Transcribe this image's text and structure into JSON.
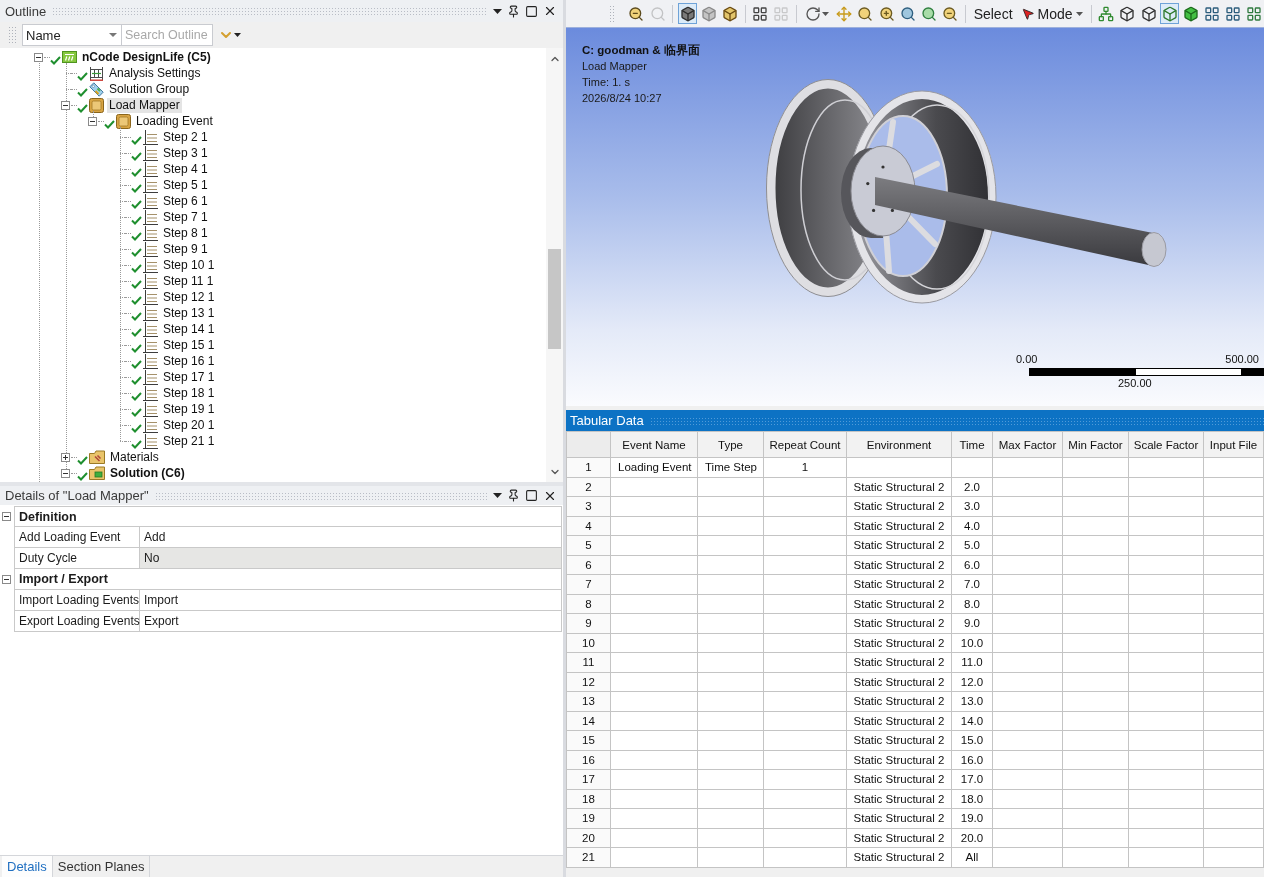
{
  "outline": {
    "title": "Outline",
    "filter": {
      "value": "Name"
    },
    "search": {
      "placeholder": "Search Outline"
    },
    "tree": [
      {
        "label": "nCode DesignLife (C5)",
        "kind": "system",
        "solved": true,
        "expanded": true,
        "selected": false,
        "children": [
          {
            "label": "Analysis Settings",
            "kind": "settings",
            "solved": true,
            "selected": false
          },
          {
            "label": "Solution Group",
            "kind": "group",
            "solved": true,
            "selected": false
          },
          {
            "label": "Load Mapper",
            "kind": "mapper",
            "solved": true,
            "expanded": true,
            "selected": true,
            "children": [
              {
                "label": "Loading Event",
                "kind": "event",
                "solved": true,
                "expanded": true,
                "selected": false,
                "children": [
                  {
                    "label": "Step 2 1",
                    "kind": "step",
                    "solved": true,
                    "selected": false
                  },
                  {
                    "label": "Step 3 1",
                    "kind": "step",
                    "solved": true,
                    "selected": false
                  },
                  {
                    "label": "Step 4 1",
                    "kind": "step",
                    "solved": true,
                    "selected": false
                  },
                  {
                    "label": "Step 5 1",
                    "kind": "step",
                    "solved": true,
                    "selected": false
                  },
                  {
                    "label": "Step 6 1",
                    "kind": "step",
                    "solved": true,
                    "selected": false
                  },
                  {
                    "label": "Step 7 1",
                    "kind": "step",
                    "solved": true,
                    "selected": false
                  },
                  {
                    "label": "Step 8 1",
                    "kind": "step",
                    "solved": true,
                    "selected": false
                  },
                  {
                    "label": "Step 9 1",
                    "kind": "step",
                    "solved": true,
                    "selected": false
                  },
                  {
                    "label": "Step 10 1",
                    "kind": "step",
                    "solved": true,
                    "selected": false
                  },
                  {
                    "label": "Step 11 1",
                    "kind": "step",
                    "solved": true,
                    "selected": false
                  },
                  {
                    "label": "Step 12 1",
                    "kind": "step",
                    "solved": true,
                    "selected": false
                  },
                  {
                    "label": "Step 13 1",
                    "kind": "step",
                    "solved": true,
                    "selected": false
                  },
                  {
                    "label": "Step 14 1",
                    "kind": "step",
                    "solved": true,
                    "selected": false
                  },
                  {
                    "label": "Step 15 1",
                    "kind": "step",
                    "solved": true,
                    "selected": false
                  },
                  {
                    "label": "Step 16 1",
                    "kind": "step",
                    "solved": true,
                    "selected": false
                  },
                  {
                    "label": "Step 17 1",
                    "kind": "step",
                    "solved": true,
                    "selected": false
                  },
                  {
                    "label": "Step 18 1",
                    "kind": "step",
                    "solved": true,
                    "selected": false
                  },
                  {
                    "label": "Step 19 1",
                    "kind": "step",
                    "solved": true,
                    "selected": false
                  },
                  {
                    "label": "Step 20 1",
                    "kind": "step",
                    "solved": true,
                    "selected": false
                  },
                  {
                    "label": "Step 21 1",
                    "kind": "step",
                    "solved": true,
                    "selected": false
                  }
                ]
              }
            ]
          },
          {
            "label": "Materials",
            "kind": "materials",
            "solved": true,
            "expanded": false,
            "selected": false
          },
          {
            "label": "Solution (C6)",
            "kind": "solution",
            "solved": true,
            "expanded": true,
            "selected": false
          }
        ]
      }
    ]
  },
  "details": {
    "title": "Details of \"Load Mapper\"",
    "groups": [
      {
        "label": "Definition",
        "expanded": true,
        "rows": [
          {
            "name": "Add Loading Event",
            "value": "Add",
            "selected": false
          },
          {
            "name": "Duty Cycle",
            "value": "No",
            "selected": true
          }
        ]
      },
      {
        "label": "Import / Export",
        "expanded": true,
        "rows": [
          {
            "name": "Import Loading Events",
            "value": "Import",
            "selected": false
          },
          {
            "name": "Export Loading Events",
            "value": "Export",
            "selected": false
          }
        ]
      }
    ]
  },
  "bottom_tabs": [
    {
      "label": "Details",
      "selected": true
    },
    {
      "label": "Section Planes",
      "selected": false
    }
  ],
  "graphics_toolbar": {
    "items": [
      {
        "kind": "icon",
        "selected": false,
        "disabled": false
      },
      {
        "kind": "icon",
        "selected": false,
        "disabled": true
      },
      {
        "kind": "separator"
      },
      {
        "kind": "icon",
        "selected": true,
        "disabled": false
      },
      {
        "kind": "icon",
        "selected": false,
        "disabled": false
      },
      {
        "kind": "icon",
        "selected": false,
        "disabled": false
      },
      {
        "kind": "separator"
      },
      {
        "kind": "icon",
        "selected": false,
        "disabled": false
      },
      {
        "kind": "icon",
        "selected": false,
        "disabled": true
      },
      {
        "kind": "separator"
      },
      {
        "kind": "dropdown",
        "selected": false,
        "disabled": false
      },
      {
        "kind": "icon",
        "selected": false,
        "disabled": false
      },
      {
        "kind": "icon",
        "selected": false,
        "disabled": false
      },
      {
        "kind": "icon",
        "selected": false,
        "disabled": false
      },
      {
        "kind": "icon",
        "selected": false,
        "disabled": false
      },
      {
        "kind": "icon",
        "selected": false,
        "disabled": false
      },
      {
        "kind": "icon",
        "selected": false,
        "disabled": false
      },
      {
        "kind": "separator"
      },
      {
        "kind": "text",
        "label": "Select"
      },
      {
        "kind": "mode",
        "label": "Mode"
      },
      {
        "kind": "separator"
      },
      {
        "kind": "icon",
        "selected": false,
        "disabled": false
      },
      {
        "kind": "icon",
        "selected": false,
        "disabled": false
      },
      {
        "kind": "icon",
        "selected": false,
        "disabled": false
      },
      {
        "kind": "icon",
        "selected": true,
        "disabled": false
      },
      {
        "kind": "icon",
        "selected": false,
        "disabled": false
      },
      {
        "kind": "icon",
        "selected": false,
        "disabled": false
      },
      {
        "kind": "icon",
        "selected": false,
        "disabled": false
      },
      {
        "kind": "icon",
        "selected": false,
        "disabled": false
      }
    ]
  },
  "viewport": {
    "annotation": {
      "title": "C: goodman & 临界面",
      "lines": [
        "Load Mapper",
        "Time: 1. s",
        "2026/8/24 10:27"
      ]
    },
    "scale_bar": {
      "start": "0.00",
      "middle": "250.00",
      "end": "500.00"
    }
  },
  "tabular_data": {
    "title": "Tabular Data",
    "columns": [
      "Event Name",
      "Type",
      "Repeat Count",
      "Environment",
      "Time",
      "Max Factor",
      "Min Factor",
      "Scale Factor",
      "Input File"
    ],
    "rows": [
      {
        "number": "1",
        "event_name": "Loading Event",
        "type": "Time Step",
        "repeat_count": "1"
      },
      {
        "number": "2",
        "environment": "Static Structural 2",
        "time": "2.0"
      },
      {
        "number": "3",
        "environment": "Static Structural 2",
        "time": "3.0"
      },
      {
        "number": "4",
        "environment": "Static Structural 2",
        "time": "4.0"
      },
      {
        "number": "5",
        "environment": "Static Structural 2",
        "time": "5.0"
      },
      {
        "number": "6",
        "environment": "Static Structural 2",
        "time": "6.0"
      },
      {
        "number": "7",
        "environment": "Static Structural 2",
        "time": "7.0"
      },
      {
        "number": "8",
        "environment": "Static Structural 2",
        "time": "8.0"
      },
      {
        "number": "9",
        "environment": "Static Structural 2",
        "time": "9.0"
      },
      {
        "number": "10",
        "environment": "Static Structural 2",
        "time": "10.0"
      },
      {
        "number": "11",
        "environment": "Static Structural 2",
        "time": "11.0"
      },
      {
        "number": "12",
        "environment": "Static Structural 2",
        "time": "12.0"
      },
      {
        "number": "13",
        "environment": "Static Structural 2",
        "time": "13.0"
      },
      {
        "number": "14",
        "environment": "Static Structural 2",
        "time": "14.0"
      },
      {
        "number": "15",
        "environment": "Static Structural 2",
        "time": "15.0"
      },
      {
        "number": "16",
        "environment": "Static Structural 2",
        "time": "16.0"
      },
      {
        "number": "17",
        "environment": "Static Structural 2",
        "time": "17.0"
      },
      {
        "number": "18",
        "environment": "Static Structural 2",
        "time": "18.0"
      },
      {
        "number": "19",
        "environment": "Static Structural 2",
        "time": "19.0"
      },
      {
        "number": "20",
        "environment": "Static Structural 2",
        "time": "20.0"
      },
      {
        "number": "21",
        "environment": "Static Structural 2",
        "time": "All"
      }
    ]
  }
}
